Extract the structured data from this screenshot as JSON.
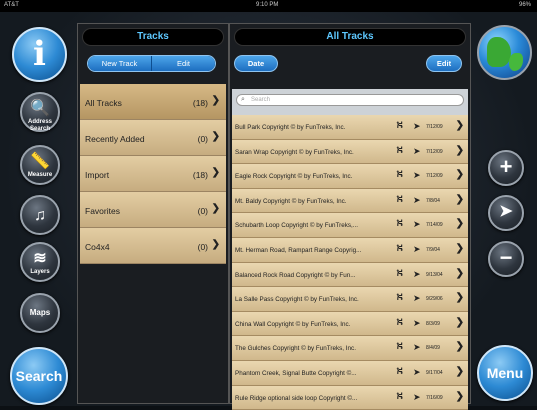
{
  "status": {
    "carrier": "AT&T",
    "time": "9:10 PM",
    "battery": "96%"
  },
  "rail": {
    "info_label": "i",
    "tools": [
      {
        "icon": "magnifier-icon",
        "glyph": "🔍",
        "label": "Address Search"
      },
      {
        "icon": "ruler-icon",
        "glyph": "📏",
        "label": "Measure"
      },
      {
        "icon": "music-note-icon",
        "glyph": "♫",
        "label": ""
      },
      {
        "icon": "layers-icon",
        "glyph": "≋",
        "label": "Layers"
      },
      {
        "icon": "maps-icon",
        "glyph": "",
        "label": "Maps"
      }
    ],
    "search_label": "Search",
    "menu_label": "Menu",
    "zoom_in": "+",
    "locate": "➤",
    "zoom_out": "−"
  },
  "left": {
    "title": "Tracks",
    "new_track": "New Track",
    "edit": "Edit",
    "items": [
      {
        "name": "All Tracks",
        "count": "(18)"
      },
      {
        "name": "Recently Added",
        "count": "(0)"
      },
      {
        "name": "Import",
        "count": "(18)"
      },
      {
        "name": "Favorites",
        "count": "(0)"
      },
      {
        "name": "Co4x4",
        "count": "(0)"
      }
    ]
  },
  "right": {
    "title": "All Tracks",
    "date_btn": "Date",
    "edit_btn": "Edit",
    "search_placeholder": "Search",
    "tracks": [
      {
        "title": "Bull Park Copyright © by FunTreks, Inc.",
        "date": "7/12/09"
      },
      {
        "title": "Saran Wrap Copyright © by FunTreks, Inc.",
        "date": "7/12/09"
      },
      {
        "title": "Eagle Rock Copyright © by FunTreks, Inc.",
        "date": "7/12/09"
      },
      {
        "title": "Mt. Baldy Copyright © by FunTreks, Inc.",
        "date": "7/8/04"
      },
      {
        "title": "Schubarth Loop Copyright © by FunTreks,...",
        "date": "7/14/09"
      },
      {
        "title": "Mt. Herman Road, Rampart Range Copyrig...",
        "date": "7/9/04"
      },
      {
        "title": "Balanced Rock Road Copyright © by Fun...",
        "date": "9/13/04"
      },
      {
        "title": "La Salle Pass Copyright © by FunTreks, Inc.",
        "date": "9/29/06"
      },
      {
        "title": "China Wall Copyright © by FunTreks, Inc.",
        "date": "8/3/09"
      },
      {
        "title": "The Gulches Copyright © by FunTreks, Inc.",
        "date": "8/4/09"
      },
      {
        "title": "Phantom Creek, Signal Butte Copyright ©...",
        "date": "9/17/04"
      },
      {
        "title": "Rule Ridge optional side loop Copyright ©...",
        "date": "7/16/09"
      }
    ]
  }
}
